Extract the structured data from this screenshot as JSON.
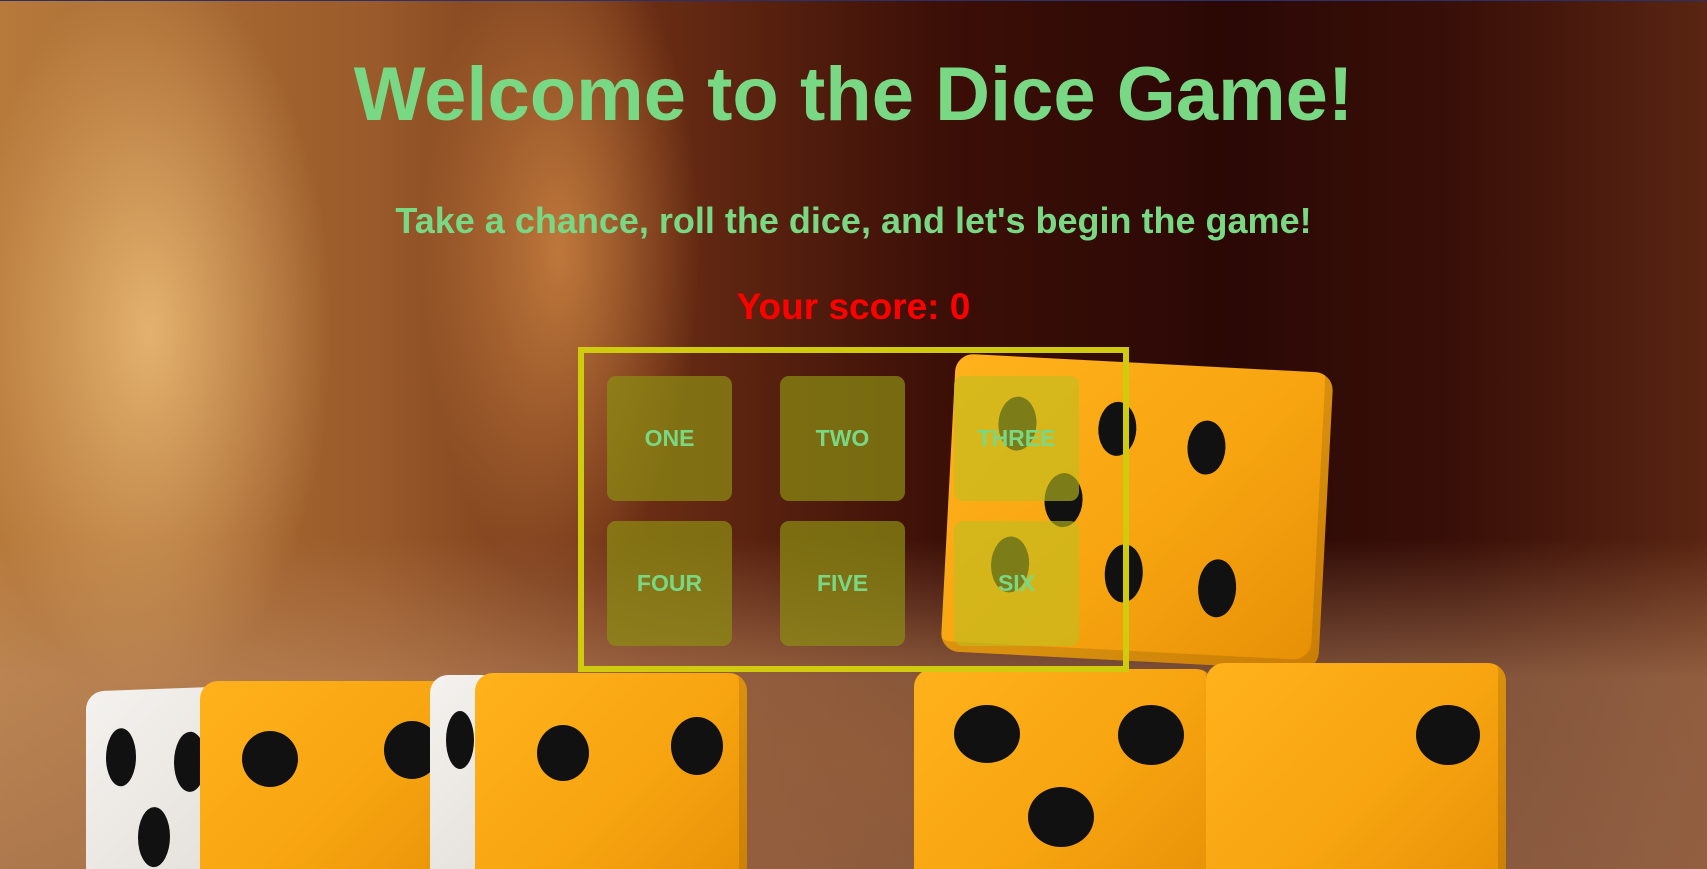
{
  "header": {
    "title": "Welcome to the Dice Game!",
    "subtitle": "Take a chance, roll the dice, and let's begin the game!"
  },
  "score": {
    "label": "Your score:",
    "value": "0"
  },
  "board": {
    "choices": [
      {
        "label": "ONE"
      },
      {
        "label": "TWO"
      },
      {
        "label": "THREE"
      },
      {
        "label": "FOUR"
      },
      {
        "label": "FIVE"
      },
      {
        "label": "SIX"
      }
    ]
  },
  "colors": {
    "heading": "#79d884",
    "score": "#ff0000",
    "board_border": "#d0cb0f",
    "choice_tile": "#8c8c14"
  }
}
